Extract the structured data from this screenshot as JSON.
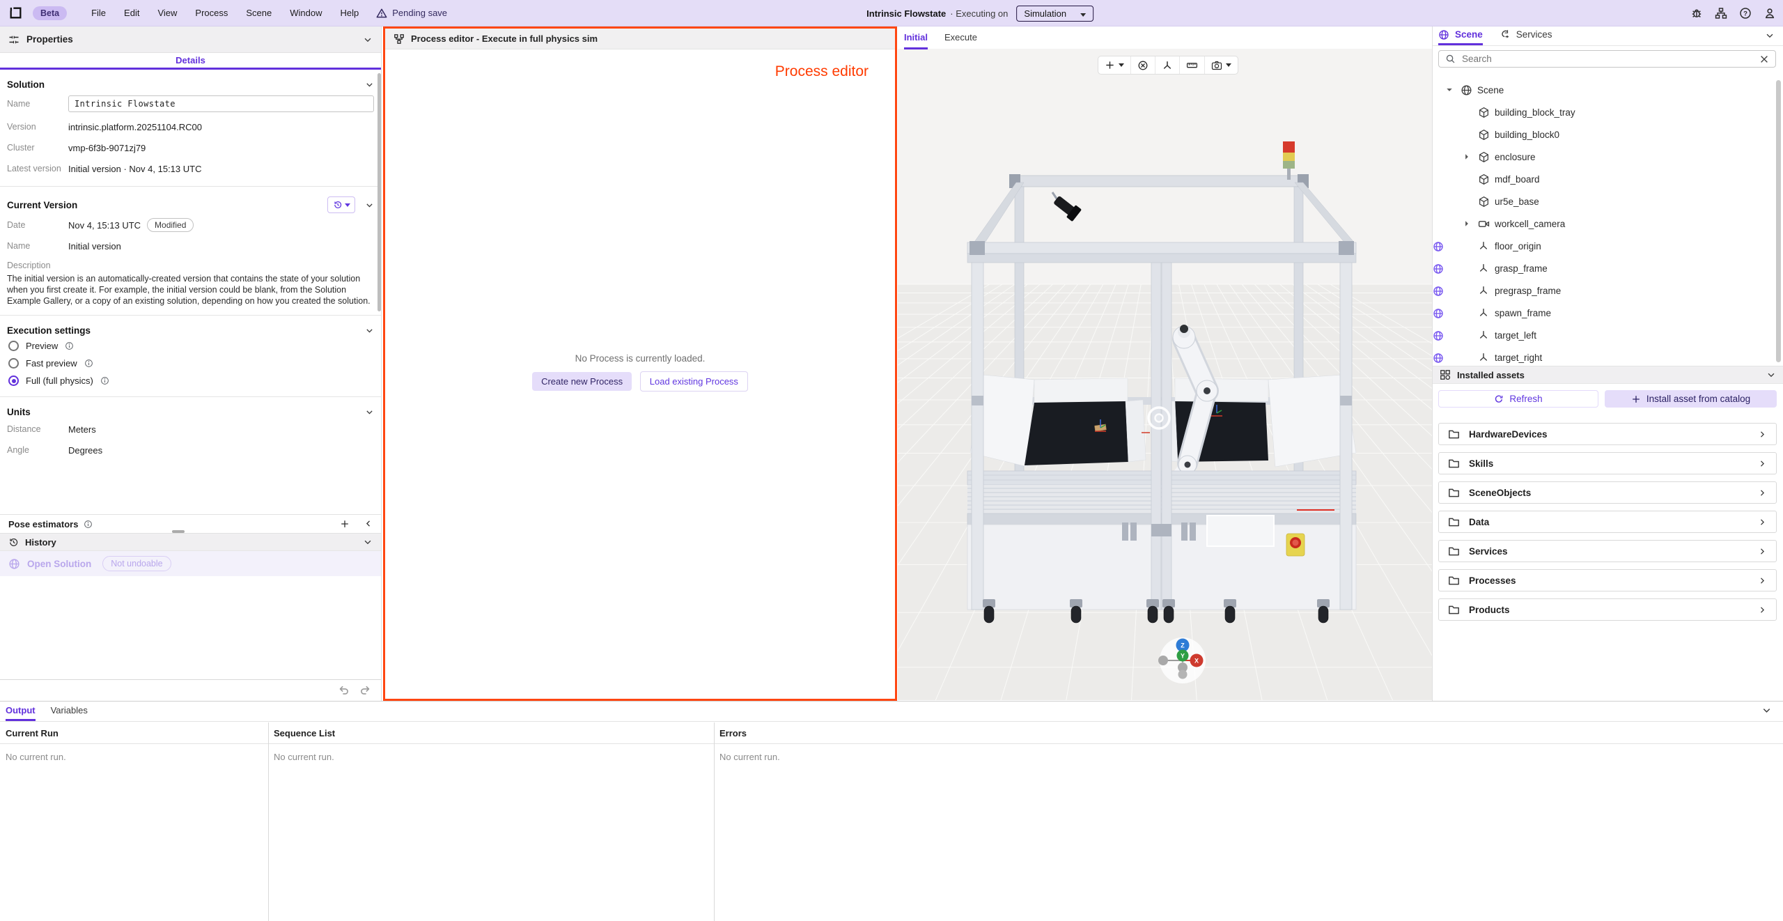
{
  "menubar": {
    "beta_badge": "Beta",
    "menus": [
      {
        "label": "File"
      },
      {
        "label": "Edit"
      },
      {
        "label": "View"
      },
      {
        "label": "Process"
      },
      {
        "label": "Scene"
      },
      {
        "label": "Window"
      },
      {
        "label": "Help"
      }
    ],
    "pending_save": "Pending save",
    "app_title": "Intrinsic Flowstate",
    "executing_prefix": "· Executing on",
    "execution_target": "Simulation"
  },
  "left_panel": {
    "title": "Properties",
    "tab": "Details",
    "solution": {
      "title": "Solution",
      "name_label": "Name",
      "name_value": "Intrinsic Flowstate",
      "version_label": "Version",
      "version_value": "intrinsic.platform.20251104.RC00",
      "cluster_label": "Cluster",
      "cluster_value": "vmp-6f3b-9071zj79",
      "latest_label": "Latest version",
      "latest_value": "Initial version · Nov 4, 15:13 UTC"
    },
    "current_version": {
      "title": "Current Version",
      "date_label": "Date",
      "date_value": "Nov 4, 15:13 UTC",
      "modified_badge": "Modified",
      "name_label": "Name",
      "name_value": "Initial version",
      "description_label": "Description",
      "description_text": "The initial version is an automatically-created version that contains the state of your solution when you first create it. For example, the initial version could be blank, from the Solution Example Gallery, or a copy of an existing solution, depending on how you created the solution."
    },
    "execution_settings": {
      "title": "Execution settings",
      "options": [
        {
          "label": "Preview",
          "selected": false
        },
        {
          "label": "Fast preview",
          "selected": false
        },
        {
          "label": "Full (full physics)",
          "selected": true
        }
      ]
    },
    "units": {
      "title": "Units",
      "distance_label": "Distance",
      "distance_value": "Meters",
      "angle_label": "Angle",
      "angle_value": "Degrees"
    },
    "pose_estimators_title": "Pose estimators",
    "history": {
      "title": "History",
      "entry_label": "Open Solution",
      "entry_badge": "Not undoable"
    }
  },
  "process_editor": {
    "header_title": "Process editor - Execute in full physics sim",
    "overlay_label": "Process editor",
    "empty_message": "No Process is currently loaded.",
    "create_button": "Create new Process",
    "load_button": "Load existing Process"
  },
  "viewport": {
    "tabs": [
      {
        "label": "Initial",
        "active": true
      },
      {
        "label": "Execute",
        "active": false
      }
    ],
    "gizmo": {
      "x": "X",
      "y": "Y",
      "z": "Z"
    }
  },
  "right_panel": {
    "scene_tab": "Scene",
    "services_tab": "Services",
    "search_placeholder": "Search",
    "tree": [
      {
        "label": "Scene",
        "root": true,
        "expand_down": true,
        "globe_dark": true
      },
      {
        "label": "building_block_tray",
        "cube": true
      },
      {
        "label": "building_block0",
        "cube": true
      },
      {
        "label": "enclosure",
        "cube": true,
        "expand_right": true
      },
      {
        "label": "mdf_board",
        "cube": true
      },
      {
        "label": "ur5e_base",
        "cube": true
      },
      {
        "label": "workcell_camera",
        "camera": true,
        "expand_right": true
      },
      {
        "label": "floor_origin",
        "frame": true,
        "globe_badge": true
      },
      {
        "label": "grasp_frame",
        "frame": true,
        "globe_badge": true
      },
      {
        "label": "pregrasp_frame",
        "frame": true,
        "globe_badge": true
      },
      {
        "label": "spawn_frame",
        "frame": true,
        "globe_badge": true
      },
      {
        "label": "target_left",
        "frame": true,
        "globe_badge": true
      },
      {
        "label": "target_right",
        "frame": true,
        "globe_badge": true
      }
    ],
    "installed_assets": {
      "title": "Installed assets",
      "refresh_button": "Refresh",
      "install_button": "Install asset from catalog",
      "folders": [
        {
          "label": "HardwareDevices"
        },
        {
          "label": "Skills"
        },
        {
          "label": "SceneObjects"
        },
        {
          "label": "Data"
        },
        {
          "label": "Services"
        },
        {
          "label": "Processes"
        },
        {
          "label": "Products"
        }
      ]
    }
  },
  "bottom_panel": {
    "tabs": [
      {
        "label": "Output",
        "active": true
      },
      {
        "label": "Variables",
        "active": false
      }
    ],
    "columns": [
      {
        "header": "Current Run",
        "empty": "No current run."
      },
      {
        "header": "Sequence List",
        "empty": "No current run."
      },
      {
        "header": "Errors",
        "empty": "No current run."
      }
    ]
  },
  "colors": {
    "accent": "#6231DC",
    "alert_border": "#FF4712",
    "annotation_red": "#FF3B00",
    "menubar_bg": "#E4DDF7"
  }
}
